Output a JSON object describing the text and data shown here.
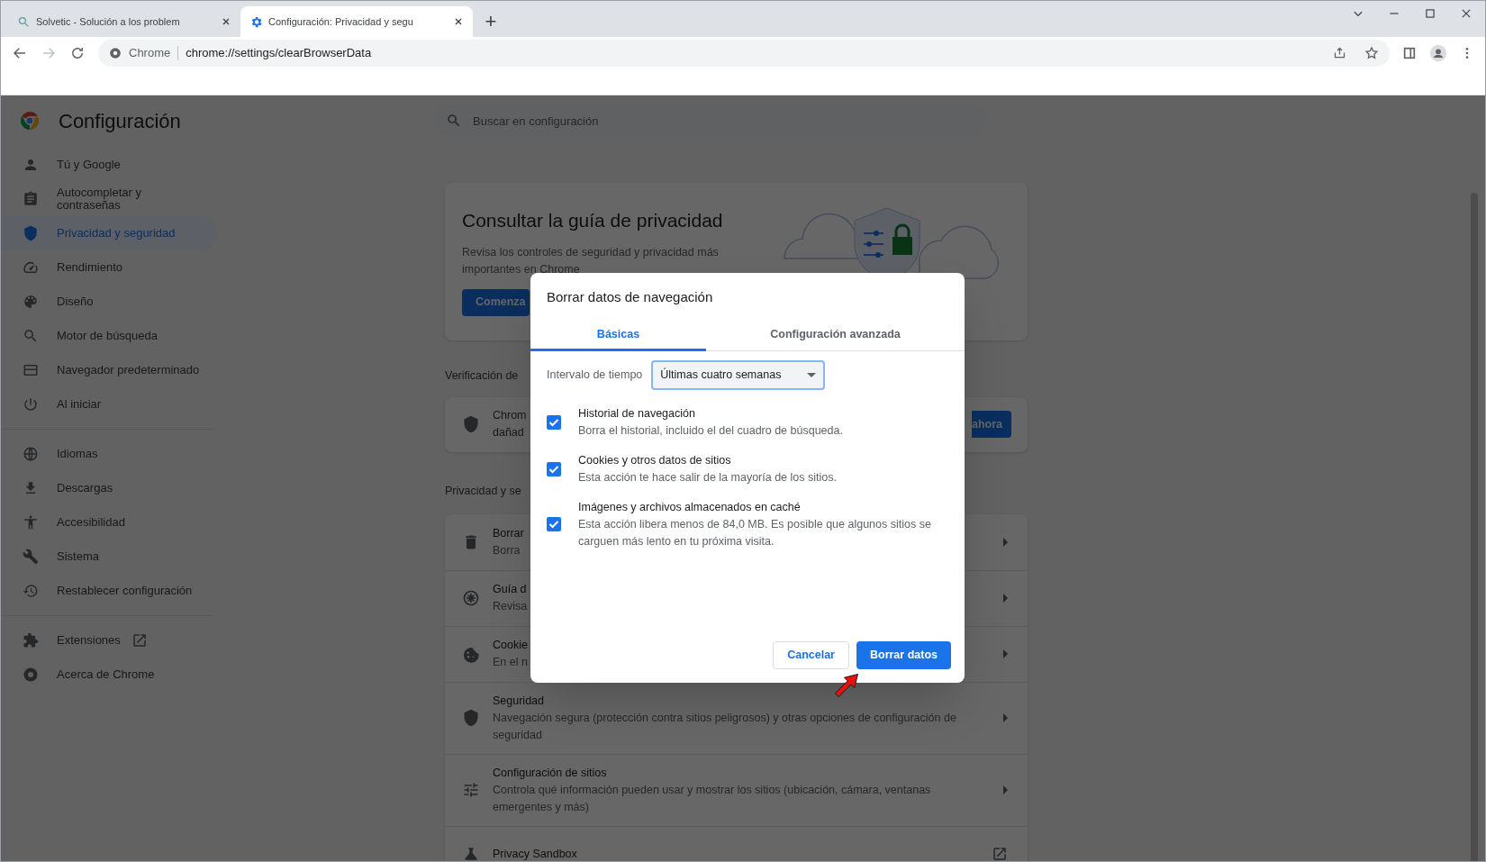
{
  "browser": {
    "tabs": [
      {
        "title": "Solvetic - Solución a los problem",
        "selected": false
      },
      {
        "title": "Configuración: Privacidad y segu",
        "selected": true
      }
    ],
    "new_tab": "+",
    "address": {
      "site_label": "Chrome",
      "url": "chrome://settings/clearBrowserData"
    }
  },
  "settings": {
    "title": "Configuración",
    "search": {
      "placeholder": "Buscar en configuración"
    },
    "sidebar": {
      "sections": [
        {
          "items": [
            {
              "label": "Tú y Google",
              "selected": false,
              "external": false
            },
            {
              "label": "Autocompletar y contraseñas",
              "selected": false,
              "external": false
            },
            {
              "label": "Privacidad y seguridad",
              "selected": true,
              "external": false
            },
            {
              "label": "Rendimiento",
              "selected": false,
              "external": false
            },
            {
              "label": "Diseño",
              "selected": false,
              "external": false
            },
            {
              "label": "Motor de búsqueda",
              "selected": false,
              "external": false
            },
            {
              "label": "Navegador predeterminado",
              "selected": false,
              "external": false
            },
            {
              "label": "Al iniciar",
              "selected": false,
              "external": false
            }
          ]
        },
        {
          "items": [
            {
              "label": "Idiomas",
              "selected": false,
              "external": false
            },
            {
              "label": "Descargas",
              "selected": false,
              "external": false
            },
            {
              "label": "Accesibilidad",
              "selected": false,
              "external": false
            },
            {
              "label": "Sistema",
              "selected": false,
              "external": false
            },
            {
              "label": "Restablecer configuración",
              "selected": false,
              "external": false
            }
          ]
        },
        {
          "items": [
            {
              "label": "Extensiones",
              "selected": false,
              "external": true
            },
            {
              "label": "Acerca de Chrome",
              "selected": false,
              "external": false
            }
          ]
        }
      ]
    },
    "guide_card": {
      "title": "Consultar la guía de privacidad",
      "text": "Revisa los controles de seguridad y privacidad más importantes en Chrome",
      "button": "Comenza"
    },
    "safety_check": {
      "heading": "Verificación de",
      "text_lines": [
        "Chrom",
        "dañad"
      ],
      "button": "ahora"
    },
    "privacy_section": {
      "heading": "Privacidad y se",
      "rows": [
        {
          "title": "Borrar",
          "subtitle": "Borra"
        },
        {
          "title": "Guía d",
          "subtitle": "Revisa"
        },
        {
          "title": "Cookie",
          "subtitle": "En el n"
        },
        {
          "title": "Seguridad",
          "subtitle": "Navegación segura (protección contra sitios peligrosos) y otras opciones de configuración de seguridad"
        },
        {
          "title": "Configuración de sitios",
          "subtitle": "Controla qué información pueden usar y mostrar los sitios (ubicación, cámara, ventanas emergentes y más)"
        },
        {
          "title": "Privacy Sandbox"
        }
      ]
    }
  },
  "dialog": {
    "title": "Borrar datos de navegación",
    "tabs": [
      {
        "label": "Básicas",
        "selected": true
      },
      {
        "label": "Configuración avanzada",
        "selected": false
      }
    ],
    "time_range": {
      "label": "Intervalo de tiempo",
      "value": "Últimas cuatro semanas"
    },
    "options": [
      {
        "title": "Historial de navegación",
        "description": "Borra el historial, incluido el del cuadro de búsqueda.",
        "checked": true
      },
      {
        "title": "Cookies y otros datos de sitios",
        "description": "Esta acción te hace salir de la mayoría de los sitios.",
        "checked": true
      },
      {
        "title": "Imágenes y archivos almacenados en caché",
        "description": "Esta acción libera menos de 84,0 MB. Es posible que algunos sitios se carguen más lento en tu próxima visita.",
        "checked": true
      }
    ],
    "buttons": [
      {
        "label": "Cancelar",
        "kind": "secondary"
      },
      {
        "label": "Borrar datos",
        "kind": "primary"
      }
    ]
  }
}
